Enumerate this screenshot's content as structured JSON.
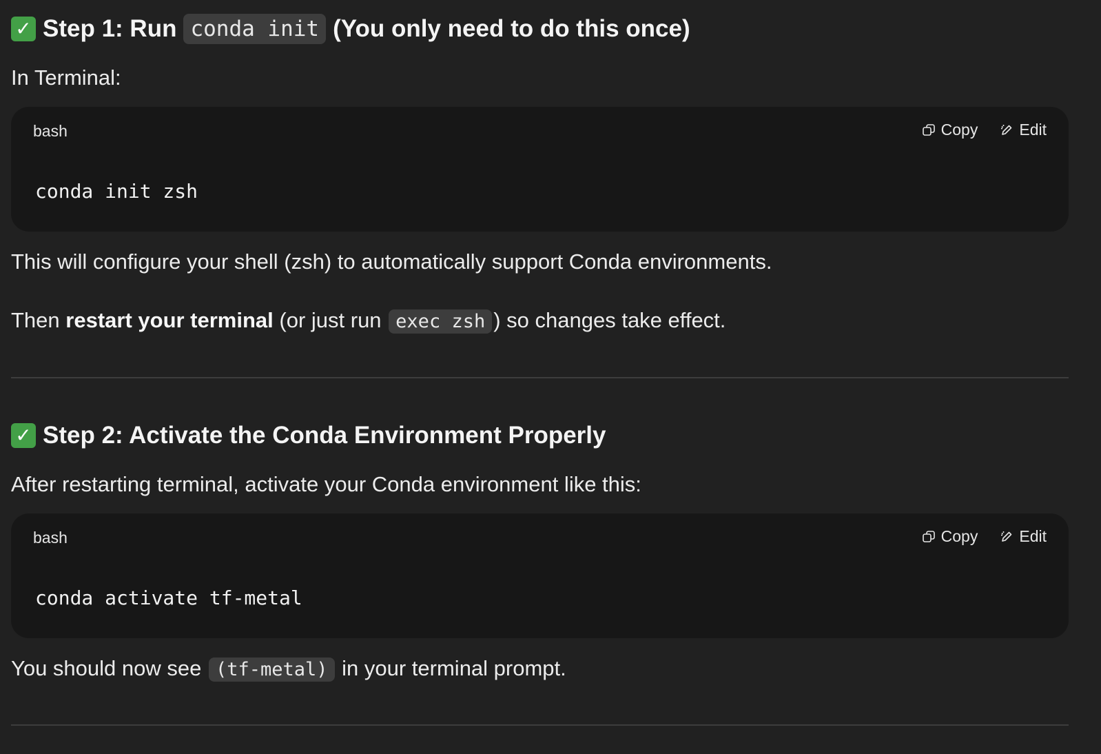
{
  "step1": {
    "check_icon": "✓",
    "title_prefix": "Step 1: Run",
    "title_code": "conda init",
    "title_suffix": "(You only need to do this once)",
    "intro": "In Terminal:",
    "code_block": {
      "language": "bash",
      "copy_label": "Copy",
      "edit_label": "Edit",
      "code": "conda init zsh"
    },
    "after_text": "This will configure your shell (zsh) to automatically support Conda environments.",
    "then_prefix": "Then ",
    "then_bold": "restart your terminal",
    "then_middle": " (or just run ",
    "then_code": "exec zsh",
    "then_suffix": ") so changes take effect."
  },
  "step2": {
    "check_icon": "✓",
    "title": "Step 2: Activate the Conda Environment Properly",
    "intro": "After restarting terminal, activate your Conda environment like this:",
    "code_block": {
      "language": "bash",
      "copy_label": "Copy",
      "edit_label": "Edit",
      "code": "conda activate tf-metal"
    },
    "after_prefix": "You should now see ",
    "after_code": "(tf-metal)",
    "after_suffix": " in your terminal prompt."
  },
  "colors": {
    "background": "#212121",
    "code_block_bg": "#171717",
    "inline_code_bg": "#3d3d3d",
    "check_green": "#43a047"
  },
  "icons": {
    "check": "check-mark-icon",
    "copy": "copy-icon",
    "edit": "pencil-edit-icon"
  }
}
